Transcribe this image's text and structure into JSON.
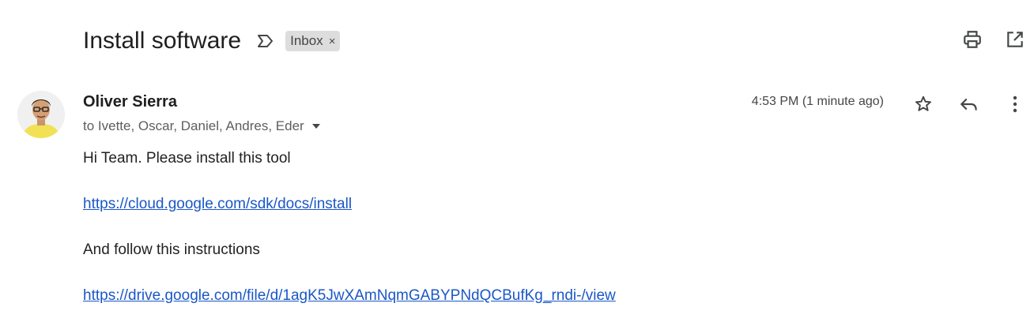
{
  "thread": {
    "subject": "Install software",
    "label": "Inbox",
    "label_remove": "×"
  },
  "icons": {
    "importance": "importance-marker-icon",
    "print": "print-icon",
    "open_new_window": "open-in-new-window-icon",
    "star": "star-icon",
    "reply": "reply-icon",
    "more": "more-vert-icon",
    "recipients_caret": "caret-down-icon"
  },
  "message": {
    "sender_name": "Oliver Sierra",
    "recipients": "to Ivette, Oscar, Daniel, Andres, Eder",
    "timestamp": "4:53 PM (1 minute ago)",
    "body": {
      "line1": "Hi Team. Please install this tool",
      "link1": "https://cloud.google.com/sdk/docs/install",
      "line2": "And follow this instructions",
      "link2": "https://drive.google.com/file/d/1agK5JwXAmNqmGABYPNdQCBufKg_rndi-/view"
    }
  },
  "colors": {
    "link": "#1a57c6",
    "chip_bg": "#dddddd",
    "text": "#1f1f1f",
    "muted": "#5e5e5e"
  }
}
